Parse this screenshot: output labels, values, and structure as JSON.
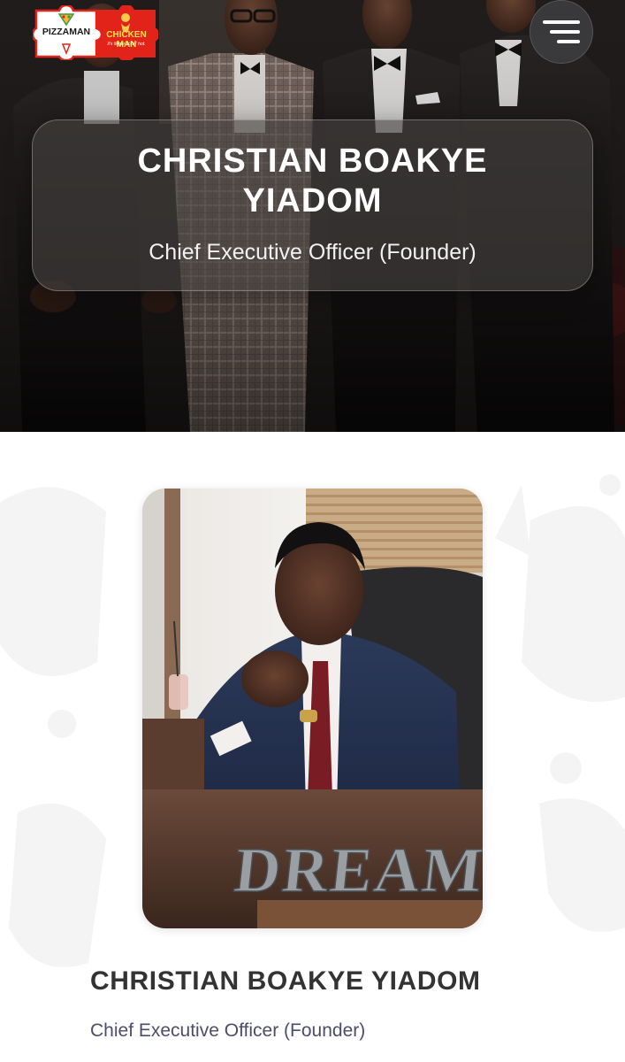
{
  "header": {
    "logo": {
      "brand_left": "PIZZAMAN",
      "brand_right": "CHICKEN MAN",
      "tagline": "it's finger lickin' hot."
    },
    "menu_icon": "hamburger-menu-icon"
  },
  "hero": {
    "name": "CHRISTIAN BOAKYE YIADOM",
    "title": "Chief Executive Officer (Founder)"
  },
  "profile": {
    "photo_sign_text": "DREAM",
    "name": "CHRISTIAN BOAKYE YIADOM",
    "title": "Chief Executive Officer (Founder)"
  },
  "colors": {
    "hero_dark": "#1d1a19",
    "card_overlay": "#46423f",
    "heading_text": "#333333",
    "subtitle_text": "#4d4d6b",
    "logo_red": "#e2231a",
    "logo_green": "#3c9a3c"
  }
}
